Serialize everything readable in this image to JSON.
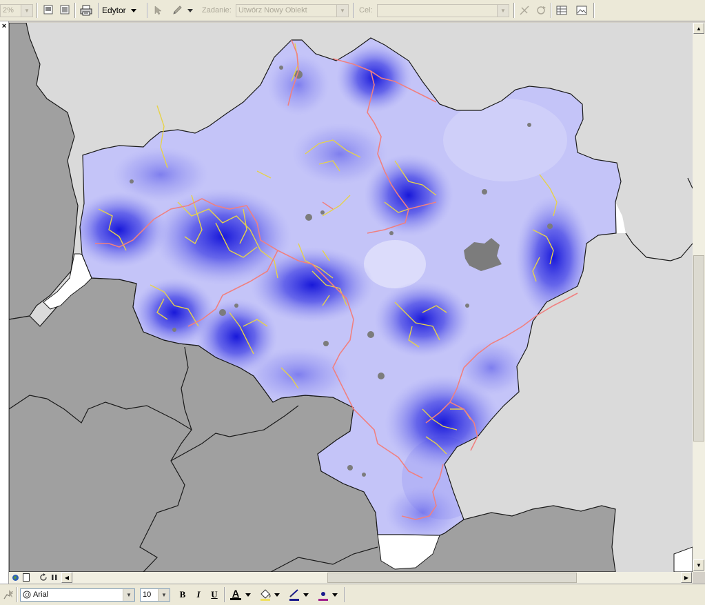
{
  "top_toolbar": {
    "zoom_value": "2%",
    "editor_label": "Edytor",
    "task_label": "Zadanie:",
    "task_value": "Utwórz Nowy Obiekt",
    "target_label": "Cel:",
    "target_value": ""
  },
  "bottom_toolbar": {
    "font_value": "Arial",
    "font_size_value": "10",
    "bold_label": "B",
    "italic_label": "I",
    "underline_label": "U",
    "font_color_glyph": "A"
  },
  "left_strip": {
    "close_glyph": "×"
  },
  "colors": {
    "map_background": "#dadada",
    "neighbor_region": "#a0a0a0",
    "region_light": "#c4c4f8",
    "region_dark": "#0f0fd8",
    "roads_main": "#f08080",
    "roads_secondary": "#e6d24a",
    "urban": "#7c7c7c"
  },
  "icons": {
    "window_close": "close-icon",
    "editor_dropdown": "chevron-down-icon",
    "edit_tool": "arrow-cursor-icon",
    "sketch_tool": "pencil-icon",
    "attributes": "table-icon",
    "sketch_properties": "image-icon"
  }
}
